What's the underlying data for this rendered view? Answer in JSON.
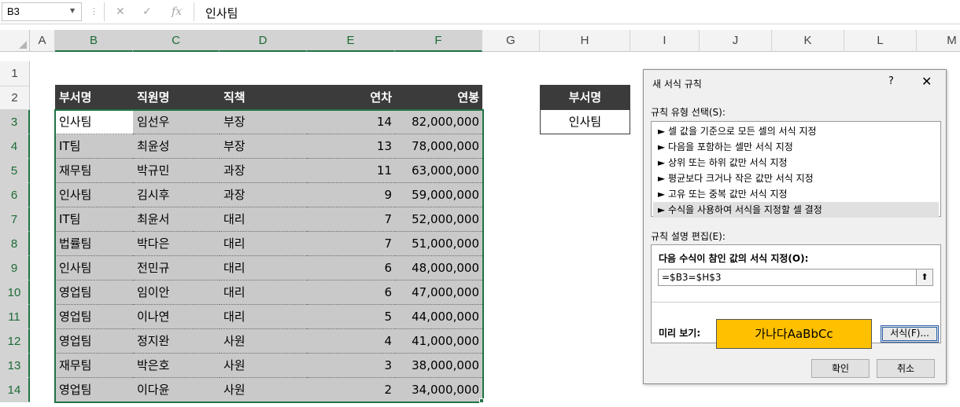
{
  "formula_bar": {
    "name_box": "B3",
    "separator": "⋮",
    "cancel": "✕",
    "enter": "✓",
    "fx": "fx",
    "content": "인사팀"
  },
  "columns": [
    "A",
    "B",
    "C",
    "D",
    "E",
    "F",
    "G",
    "H",
    "I",
    "J",
    "K",
    "L",
    "M"
  ],
  "rows": [
    "1",
    "2",
    "3",
    "4",
    "5",
    "6",
    "7",
    "8",
    "9",
    "10",
    "11",
    "12",
    "13",
    "14"
  ],
  "table": {
    "headers": [
      "부서명",
      "직원명",
      "직책",
      "연차",
      "연봉"
    ],
    "rows": [
      [
        "인사팀",
        "임선우",
        "부장",
        "14",
        "82,000,000"
      ],
      [
        "IT팀",
        "최윤성",
        "부장",
        "13",
        "78,000,000"
      ],
      [
        "재무팀",
        "박규민",
        "과장",
        "11",
        "63,000,000"
      ],
      [
        "인사팀",
        "김시후",
        "과장",
        "9",
        "59,000,000"
      ],
      [
        "IT팀",
        "최윤서",
        "대리",
        "7",
        "52,000,000"
      ],
      [
        "법률팀",
        "박다은",
        "대리",
        "7",
        "51,000,000"
      ],
      [
        "인사팀",
        "전민규",
        "대리",
        "6",
        "48,000,000"
      ],
      [
        "영업팀",
        "임이안",
        "대리",
        "6",
        "47,000,000"
      ],
      [
        "영업팀",
        "이나연",
        "대리",
        "5",
        "44,000,000"
      ],
      [
        "영업팀",
        "정지완",
        "사원",
        "4",
        "41,000,000"
      ],
      [
        "재무팀",
        "박은호",
        "사원",
        "3",
        "38,000,000"
      ],
      [
        "영업팀",
        "이다윤",
        "사원",
        "2",
        "34,000,000"
      ]
    ]
  },
  "criteria": {
    "header": "부서명",
    "value": "인사팀"
  },
  "dialog": {
    "title": "새 서식 규칙",
    "help": "?",
    "close": "✕",
    "rule_type_label": "규칙 유형 선택(S):",
    "rule_types": [
      "► 셀 값을 기준으로 모든 셀의 서식 지정",
      "► 다음을 포함하는 셀만 서식 지정",
      "► 상위 또는 하위 값만 서식 지정",
      "► 평균보다 크거나 작은 값만 서식 지정",
      "► 고유 또는 중복 값만 서식 지정",
      "► 수식을 사용하여 서식을 지정할 셀 결정"
    ],
    "selected_rule_index": 5,
    "edit_label": "규칙 설명 편집(E):",
    "formula_caption": "다음 수식이 참인 값의 서식 지정(O):",
    "formula": "=$B3=$H$3",
    "collapse_icon": "⬆",
    "preview_label": "미리 보기:",
    "preview_text": "가나다AaBbCc",
    "preview_color": "#FFC000",
    "format_button": "서식(F)...",
    "ok_button": "확인",
    "cancel_button": "취소"
  }
}
